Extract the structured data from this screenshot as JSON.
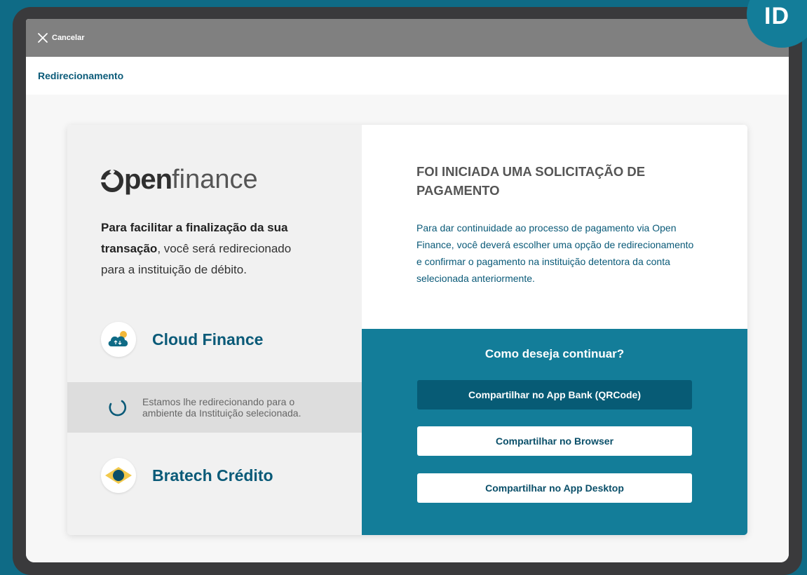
{
  "badge": {
    "label": "ID"
  },
  "topbar": {
    "cancel_label": "Cancelar"
  },
  "subbar": {
    "title": "Redirecionamento"
  },
  "left": {
    "logo": {
      "bold": "pen",
      "light": "finance"
    },
    "intro": {
      "bold": "Para facilitar a finalização da sua transação",
      "rest": ", você será redirecionado para a instituição de débito."
    },
    "institutions": [
      {
        "name": "Cloud Finance",
        "icon": "cloud-icon"
      },
      {
        "name": "Bratech Crédito",
        "icon": "diamond-icon"
      }
    ],
    "loading": {
      "text": "Estamos lhe redirecionando para o ambiente da Instituição selecionada."
    }
  },
  "right": {
    "title": "FOI INICIADA UMA SOLICITAÇÃO DE PAGAMENTO",
    "description": "Para dar continuidade ao processo de pagamento via Open Finance, você deverá escolher uma opção de redirecionamento e confirmar o pagamento na instituição detentora da conta selecionada anteriormente.",
    "question": "Como deseja continuar?",
    "buttons": [
      {
        "label": "Compartilhar no App Bank (QRCode)"
      },
      {
        "label": "Compartilhar no Browser"
      },
      {
        "label": "Compartilhar no App Desktop"
      }
    ]
  },
  "colors": {
    "teal": "#137d99",
    "dark_teal": "#075b75",
    "text_blue": "#0a5a78",
    "topbar_gray": "#808080"
  }
}
